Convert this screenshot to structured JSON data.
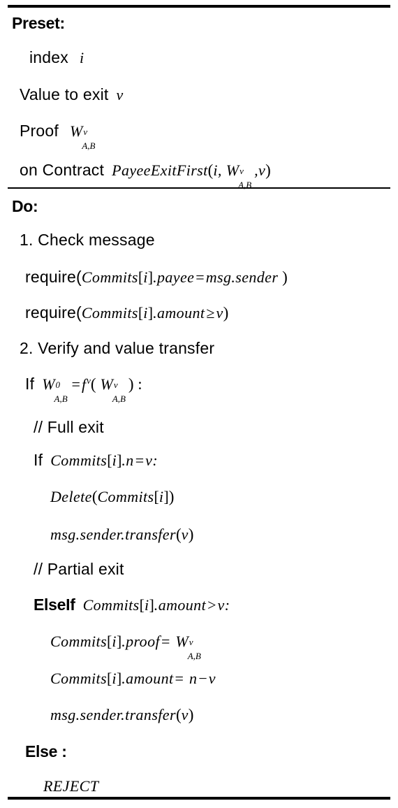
{
  "document": {
    "type": "algorithm-pseudocode-box",
    "sections": [
      {
        "id": "preset",
        "heading": "Preset:",
        "lines": [
          {
            "id": "index",
            "parts": [
              "index",
              "i"
            ]
          },
          {
            "id": "value-exit",
            "parts": [
              "Value to exit",
              "v"
            ]
          },
          {
            "id": "proof",
            "parts": [
              "Proof",
              "W",
              "v",
              "A,B"
            ]
          },
          {
            "id": "on-contract",
            "parts": [
              "on Contract",
              "PayeeExitFirst",
              "i",
              "W",
              "v",
              "A,B",
              "v"
            ]
          }
        ]
      },
      {
        "id": "do",
        "heading": "Do:",
        "lines": [
          {
            "id": "step1",
            "parts": [
              "1. Check message"
            ]
          },
          {
            "id": "require-payee",
            "parts": [
              "require(",
              "Commits",
              "[",
              "i",
              "]",
              ".payee",
              "=",
              "msg.sender",
              " )"
            ]
          },
          {
            "id": "require-amt",
            "parts": [
              "require(",
              "Commits",
              "[",
              "i",
              "]",
              ".amount",
              "≥",
              "v",
              ")"
            ]
          },
          {
            "id": "step2",
            "parts": [
              "2. Verify and value transfer"
            ]
          },
          {
            "id": "if-proof",
            "parts": [
              "If",
              "W",
              "0",
              "A,B",
              "=",
              "f",
              "v",
              "(",
              "W",
              "v",
              "A,B",
              ") :"
            ]
          },
          {
            "id": "comment-full",
            "parts": [
              "// Full exit"
            ]
          },
          {
            "id": "if-n-eq-v",
            "parts": [
              "If",
              "Commits",
              "[",
              "i",
              "]",
              ".n",
              "=",
              "v",
              ":"
            ]
          },
          {
            "id": "delete",
            "parts": [
              "Delete",
              "(",
              "Commits",
              "[",
              "i",
              "]",
              ")"
            ]
          },
          {
            "id": "transfer-1",
            "parts": [
              "msg.sender.transfer",
              "(",
              "v",
              ")"
            ]
          },
          {
            "id": "comment-part",
            "parts": [
              "// Partial exit"
            ]
          },
          {
            "id": "elseif",
            "parts": [
              "ElseIf",
              "Commits",
              "[",
              "i",
              "]",
              ".amount",
              ">",
              "v",
              ":"
            ]
          },
          {
            "id": "set-proof",
            "parts": [
              "Commits",
              "[",
              "i",
              "]",
              ".proof",
              "=",
              "W",
              "v",
              "A,B"
            ]
          },
          {
            "id": "set-amount",
            "parts": [
              "Commits",
              "[",
              "i",
              "]",
              ".amount",
              "=",
              "n",
              "−",
              "v"
            ]
          },
          {
            "id": "transfer-2",
            "parts": [
              "msg.sender.transfer",
              "(",
              "v",
              ")"
            ]
          },
          {
            "id": "else",
            "parts": [
              "Else :"
            ]
          },
          {
            "id": "reject",
            "parts": [
              "REJECT"
            ]
          }
        ]
      }
    ],
    "text": {
      "preset_heading": "Preset:",
      "do_heading": "Do:",
      "index_label": "index",
      "index_var": "i",
      "value_label": "Value to exit",
      "value_var": "v",
      "proof_label": "Proof",
      "proof_w": "W",
      "proof_sup": "v",
      "proof_sub": "A,B",
      "contract_label": "on Contract",
      "contract_fn": "PayeeExitFirst",
      "contract_open": "(",
      "contract_arg1": "i,",
      "contract_w": "W",
      "contract_sup": "v",
      "contract_sub": "A,B",
      "contract_comma": ",",
      "contract_arg3": "v",
      "contract_close": ")",
      "step1": "1. Check message",
      "step2": "2. Verify and value transfer",
      "require_open": "require(",
      "commits": "Commits",
      "lbrack": "[",
      "idx": "i",
      "rbrack": "]",
      "dot_payee": ".payee",
      "eq": "=",
      "msg_sender": "msg.sender",
      "rparen_sp": " )",
      "dot_amount": ".amount",
      "geq": "≥",
      "v": "v",
      "rparen": ")",
      "if": "If",
      "w": "W",
      "sup_zero": "0",
      "sub_ab": "A,B",
      "f": "f",
      "f_sup": "v",
      "lparen": "(",
      "sup_v": "v",
      "colon_sp": ") :",
      "comment_full": "// Full exit",
      "dot_n": ".n",
      "colon": ":",
      "delete_fn": "Delete",
      "transfer_fn": "msg.sender.transfer",
      "comment_partial": "// Partial exit",
      "elseif": "ElseIf",
      "gt": ">",
      "dot_proof": ".proof",
      "n": "n",
      "minus": "−",
      "else": "Else :",
      "reject": "REJECT"
    },
    "colors": {
      "text": "#000000",
      "background": "#ffffff",
      "rule": "#000000"
    }
  }
}
